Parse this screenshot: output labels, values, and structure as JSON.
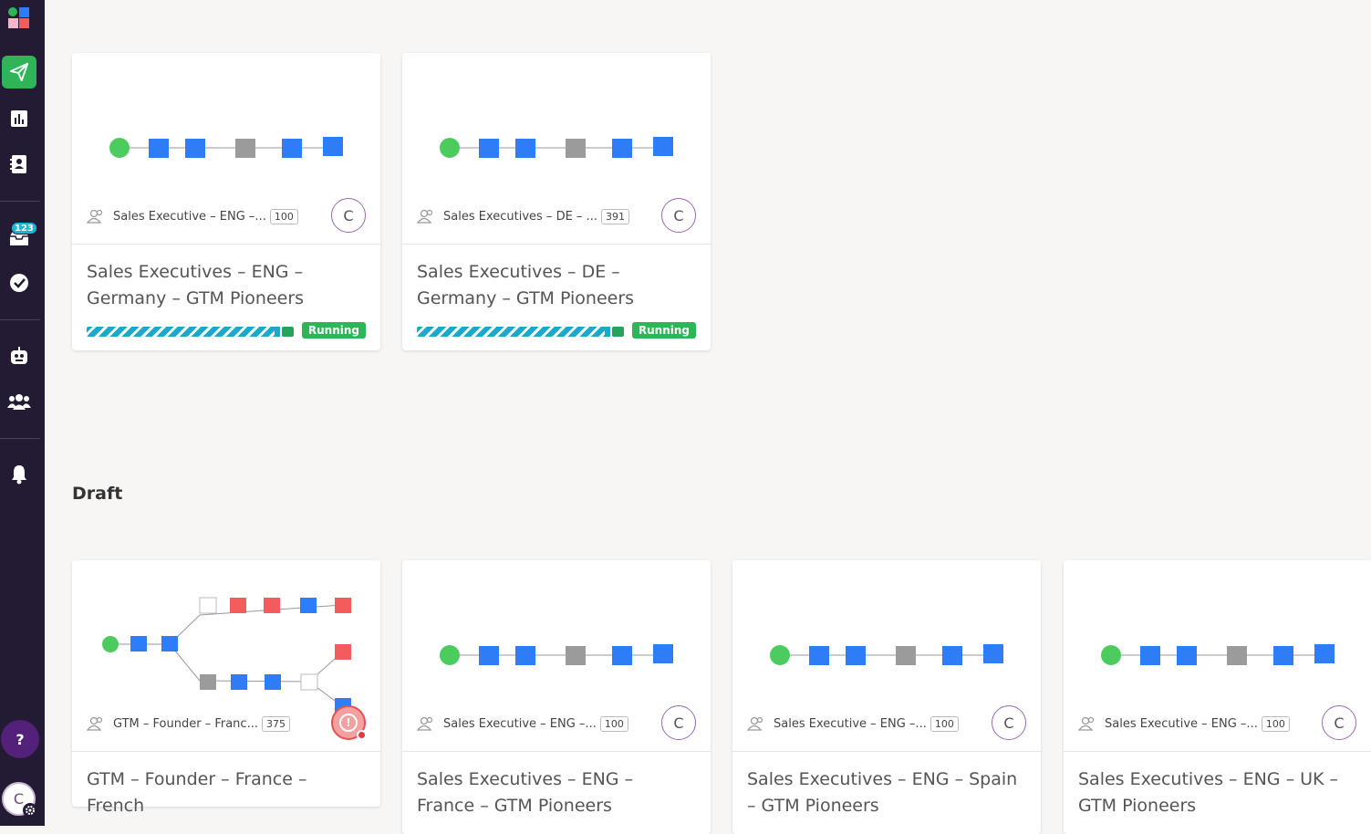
{
  "sidebar": {
    "inbox_badge": "123",
    "help_label": "?",
    "user_initial": "C"
  },
  "sections": {
    "draft_title": "Draft"
  },
  "running_cards": [
    {
      "audience": "Sales Executive – ENG –...",
      "count": "100",
      "owner": "C",
      "title": "Sales Executives – ENG – Germany – GTM Pioneers",
      "status": "Running",
      "progress": 0.93
    },
    {
      "audience": "Sales Executives – DE – ...",
      "count": "391",
      "owner": "C",
      "title": "Sales Executives – DE – Germany – GTM Pioneers",
      "status": "Running",
      "progress": 0.93
    }
  ],
  "draft_cards": [
    {
      "audience": "GTM – Founder – Franc...",
      "count": "375",
      "owner": "!",
      "title": "GTM – Founder – France – French"
    },
    {
      "audience": "Sales Executive – ENG –...",
      "count": "100",
      "owner": "C",
      "title": "Sales Executives – ENG – France – GTM Pioneers"
    },
    {
      "audience": "Sales Executive – ENG –...",
      "count": "100",
      "owner": "C",
      "title": "Sales Executives – ENG – Spain – GTM Pioneers"
    },
    {
      "audience": "Sales Executive – ENG –...",
      "count": "100",
      "owner": "C",
      "title": "Sales Executives – ENG – UK – GTM Pioneers"
    }
  ],
  "colors": {
    "sidebar_bg": "#231a33",
    "accent_green": "#2fb457",
    "node_blue": "#2f7df6",
    "node_gray": "#9b9b9b",
    "node_red": "#f25c5c",
    "progress_teal": "#1aa9c9"
  }
}
